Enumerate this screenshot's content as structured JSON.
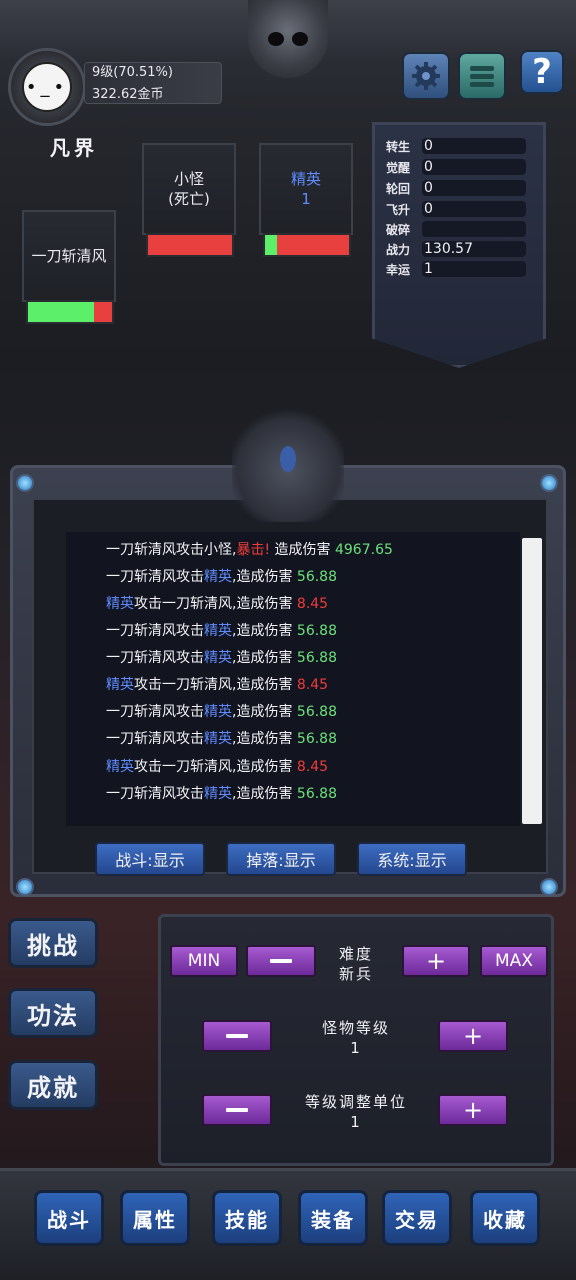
{
  "player": {
    "avatar_face": "•_•",
    "level": "9级(70.51%)",
    "gold": "322.62金币",
    "realm": "凡界"
  },
  "top_buttons": {
    "settings_icon": "gear-icon",
    "menu_icon": "menu-icon",
    "help_label": "?"
  },
  "stats": [
    {
      "label": "转生",
      "value": "0"
    },
    {
      "label": "觉醒",
      "value": "0"
    },
    {
      "label": "轮回",
      "value": "0"
    },
    {
      "label": "飞升",
      "value": "0"
    },
    {
      "label": "破碎",
      "value": ""
    },
    {
      "label": "战力",
      "value": "130.57"
    },
    {
      "label": "幸运",
      "value": "1"
    }
  ],
  "cards": {
    "player": {
      "name": "一刀斩清风",
      "hp_fraction": 0.78
    },
    "minion": {
      "line1": "小怪",
      "line2": "(死亡)",
      "hp_fraction": 0.0
    },
    "elite": {
      "line1": "精英",
      "line2": "1",
      "hp_fraction": 0.14
    }
  },
  "log": [
    {
      "a": "一刀斩清风攻击小怪,",
      "b": "暴击!",
      "c": " 造成伤害 ",
      "d": "4967.65"
    },
    {
      "a": "一刀斩清风攻击",
      "b": "精英",
      "c": ",造成伤害 ",
      "d": "56.88"
    },
    {
      "a": "精英",
      "b": "攻击一刀斩清风,造成伤害 ",
      "c": "8.45"
    },
    {
      "a": "一刀斩清风攻击",
      "b": "精英",
      "c": ",造成伤害 ",
      "d": "56.88"
    },
    {
      "a": "一刀斩清风攻击",
      "b": "精英",
      "c": ",造成伤害 ",
      "d": "56.88"
    },
    {
      "a": "精英",
      "b": "攻击一刀斩清风,造成伤害 ",
      "c": "8.45"
    },
    {
      "a": "一刀斩清风攻击",
      "b": "精英",
      "c": ",造成伤害 ",
      "d": "56.88"
    },
    {
      "a": "一刀斩清风攻击",
      "b": "精英",
      "c": ",造成伤害 ",
      "d": "56.88"
    },
    {
      "a": "精英",
      "b": "攻击一刀斩清风,造成伤害 ",
      "c": "8.45"
    },
    {
      "a": "一刀斩清风攻击",
      "b": "精英",
      "c": ",造成伤害 ",
      "d": "56.88"
    }
  ],
  "filters": {
    "battle": "战斗:显示",
    "drop": "掉落:显示",
    "system": "系统:显示"
  },
  "side_buttons": {
    "challenge": "挑战",
    "skills": "功法",
    "achievements": "成就"
  },
  "difficulty": {
    "min_label": "MIN",
    "max_label": "MAX",
    "plus": "+",
    "title": "难度",
    "value": "新兵",
    "monster_level_title": "怪物等级",
    "monster_level_value": "1",
    "unit_title": "等级调整单位",
    "unit_value": "1"
  },
  "nav": [
    "战斗",
    "属性",
    "技能",
    "装备",
    "交易",
    "收藏"
  ],
  "colors": {
    "blue_name": "#5f8bff",
    "crit_red": "#ef3b3b",
    "damage_green": "#6be07a",
    "hp_green": "#5cf06a",
    "hp_red": "#e8403f"
  }
}
